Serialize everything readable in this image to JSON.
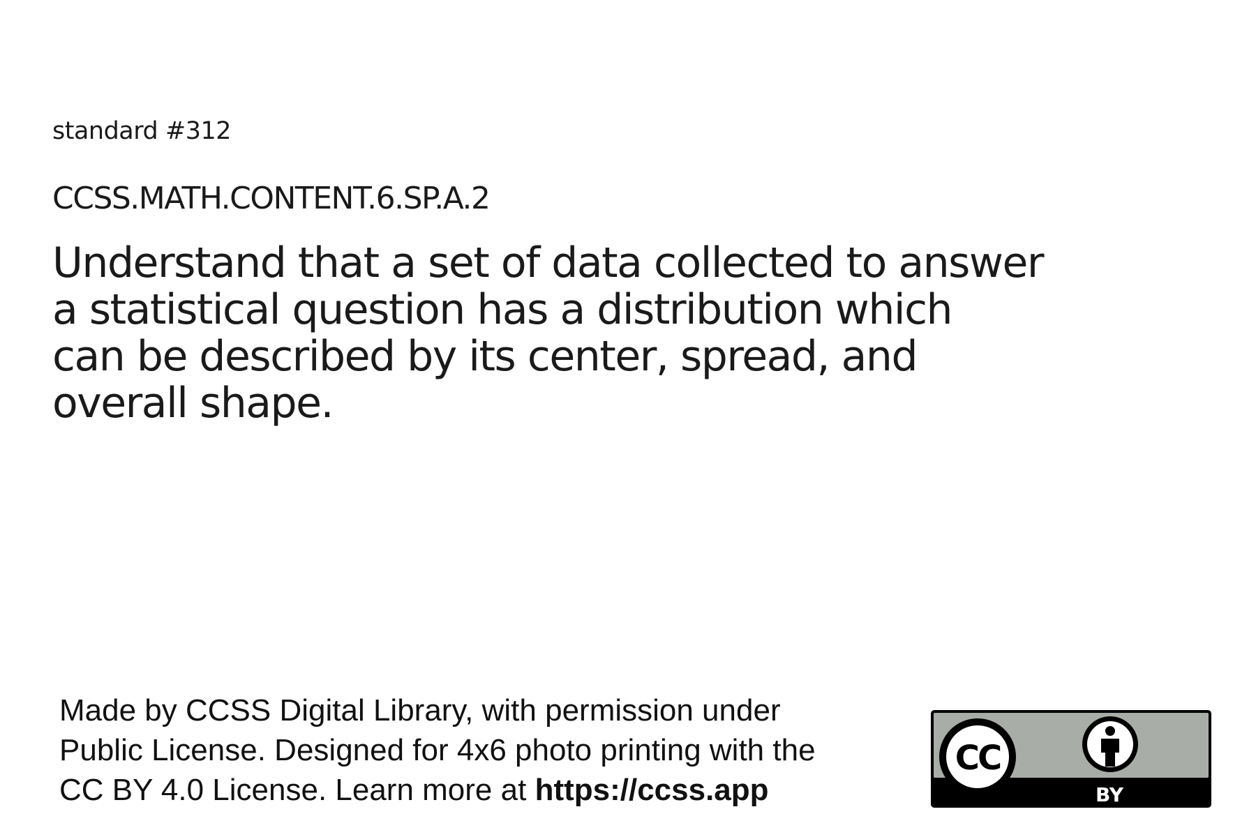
{
  "card": {
    "standard_number": "standard #312",
    "standard_code": "CCSS.MATH.CONTENT.6.SP.A.2",
    "standard_text_lines": [
      "Understand that a set of data collected to answer",
      "a statistical question has a distribution which",
      "can be described by its center, spread, and",
      "overall shape."
    ]
  },
  "attribution": {
    "line1": "Made by CCSS Digital Library, with permission under",
    "line2": "Public License. Designed for 4x6 photo printing with the",
    "line3_prefix": "CC BY 4.0 License. Learn more at ",
    "link_text": "https://ccss.app"
  },
  "license_badge": {
    "cc_text": "CC",
    "by_text": "BY",
    "icons": [
      "cc-icon",
      "person-attribution-icon"
    ],
    "colors": {
      "badge_gray": "#a9ada7",
      "badge_black": "#000000",
      "badge_white": "#ffffff"
    }
  }
}
